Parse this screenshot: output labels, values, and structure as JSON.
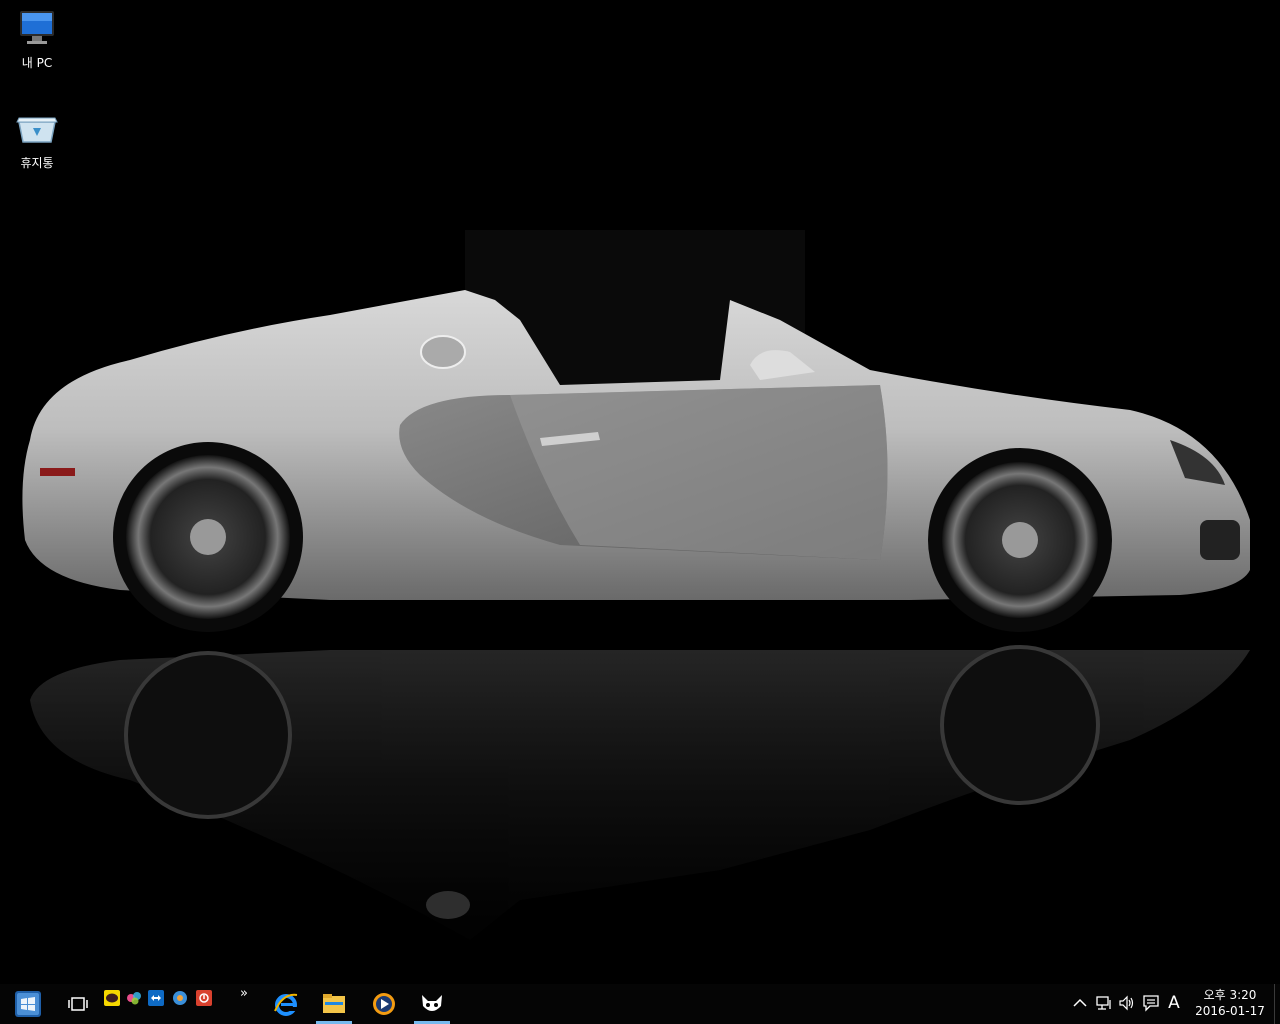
{
  "desktop": {
    "icons": [
      {
        "label": "내 PC",
        "icon": "computer-monitor-icon"
      },
      {
        "label": "휴지통",
        "icon": "recycle-bin-icon"
      }
    ],
    "wallpaper": "white sports car convertible side view on black reflective floor"
  },
  "taskbar": {
    "start_icon": "windows-start-icon",
    "task_view_icon": "task-view-icon",
    "quick_launch": [
      {
        "icon": "kakaotalk-icon",
        "label": "TALK"
      },
      {
        "icon": "color-app-icon"
      },
      {
        "icon": "teamviewer-icon"
      },
      {
        "icon": "network-app-icon"
      },
      {
        "icon": "red-app-icon"
      }
    ],
    "overflow_label": "»",
    "pinned": [
      {
        "icon": "internet-explorer-icon",
        "active": false
      },
      {
        "icon": "file-explorer-icon",
        "active": true
      },
      {
        "icon": "media-player-icon",
        "active": false
      },
      {
        "icon": "foobar-icon",
        "active": true
      }
    ],
    "tray": {
      "chevron_icon": "chevron-up-icon",
      "network_icon": "network-icon",
      "volume_icon": "volume-icon",
      "action_center_icon": "action-center-icon",
      "ime_label": "A",
      "time": "오후 3:20",
      "date": "2016-01-17"
    }
  },
  "colors": {
    "taskbar_bg": "#050505",
    "active_indicator": "#76b9ed"
  }
}
